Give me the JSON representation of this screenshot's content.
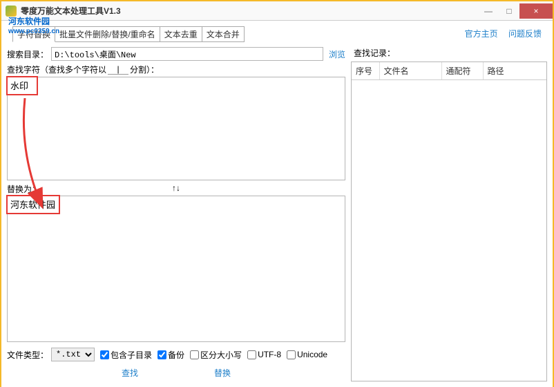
{
  "window": {
    "title": "零度万能文本处理工具V1.3",
    "min": "—",
    "max": "□",
    "close": "×"
  },
  "watermark": {
    "line1": "河东软件园",
    "line2": "www.pc0359.cn"
  },
  "tabs": [
    "字符替换",
    "批量文件删除/替换/重命名",
    "文本去重",
    "文本合并"
  ],
  "top_links": {
    "home": "官方主页",
    "feedback": "问题反馈"
  },
  "search": {
    "label": "搜索目录：",
    "value": "D:\\tools\\桌面\\New",
    "browse": "浏览"
  },
  "find": {
    "label": "查找字符",
    "hint_left": "（查找多个字符以",
    "separator": "|",
    "hint_right": "分割）：",
    "value": "水印"
  },
  "swap": {
    "label": "替换为：",
    "arrows": "↑↓"
  },
  "replace": {
    "value": "河东软件园"
  },
  "options": {
    "file_type_label": "文件类型：",
    "file_type_value": "*.txt",
    "include_sub": "包含子目录",
    "backup": "备份",
    "case_sensitive": "区分大小写",
    "utf8": "UTF-8",
    "unicode": "Unicode"
  },
  "actions": {
    "find": "查找",
    "replace": "替换"
  },
  "records": {
    "label": "查找记录：",
    "columns": [
      "序号",
      "文件名",
      "通配符",
      "路径"
    ]
  }
}
